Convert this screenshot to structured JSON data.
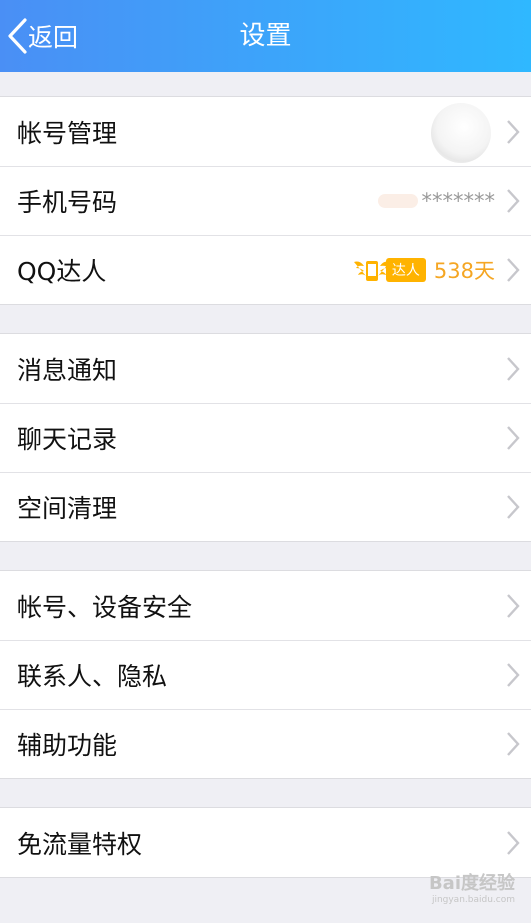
{
  "header": {
    "back_label": "返回",
    "title": "设置"
  },
  "groups": [
    {
      "items": [
        {
          "label": "帐号管理"
        },
        {
          "label": "手机号码",
          "value": "*******"
        },
        {
          "label": "QQ达人",
          "badge": "达人",
          "value": "538天"
        }
      ]
    },
    {
      "items": [
        {
          "label": "消息通知"
        },
        {
          "label": "聊天记录"
        },
        {
          "label": "空间清理"
        }
      ]
    },
    {
      "items": [
        {
          "label": "帐号、设备安全"
        },
        {
          "label": "联系人、隐私"
        },
        {
          "label": "辅助功能"
        }
      ]
    },
    {
      "items": [
        {
          "label": "免流量特权"
        }
      ]
    }
  ],
  "watermark": {
    "text": "Bai度经验",
    "sub": "jingyan.baidu.com"
  },
  "colors": {
    "nav_start": "#4a8ff5",
    "nav_end": "#2fb8ff",
    "background": "#efeff4",
    "accent_gold": "#f5a623"
  },
  "icons": [
    "back-chevron-icon",
    "chevron-right-icon",
    "qq-talent-wing-icon"
  ]
}
